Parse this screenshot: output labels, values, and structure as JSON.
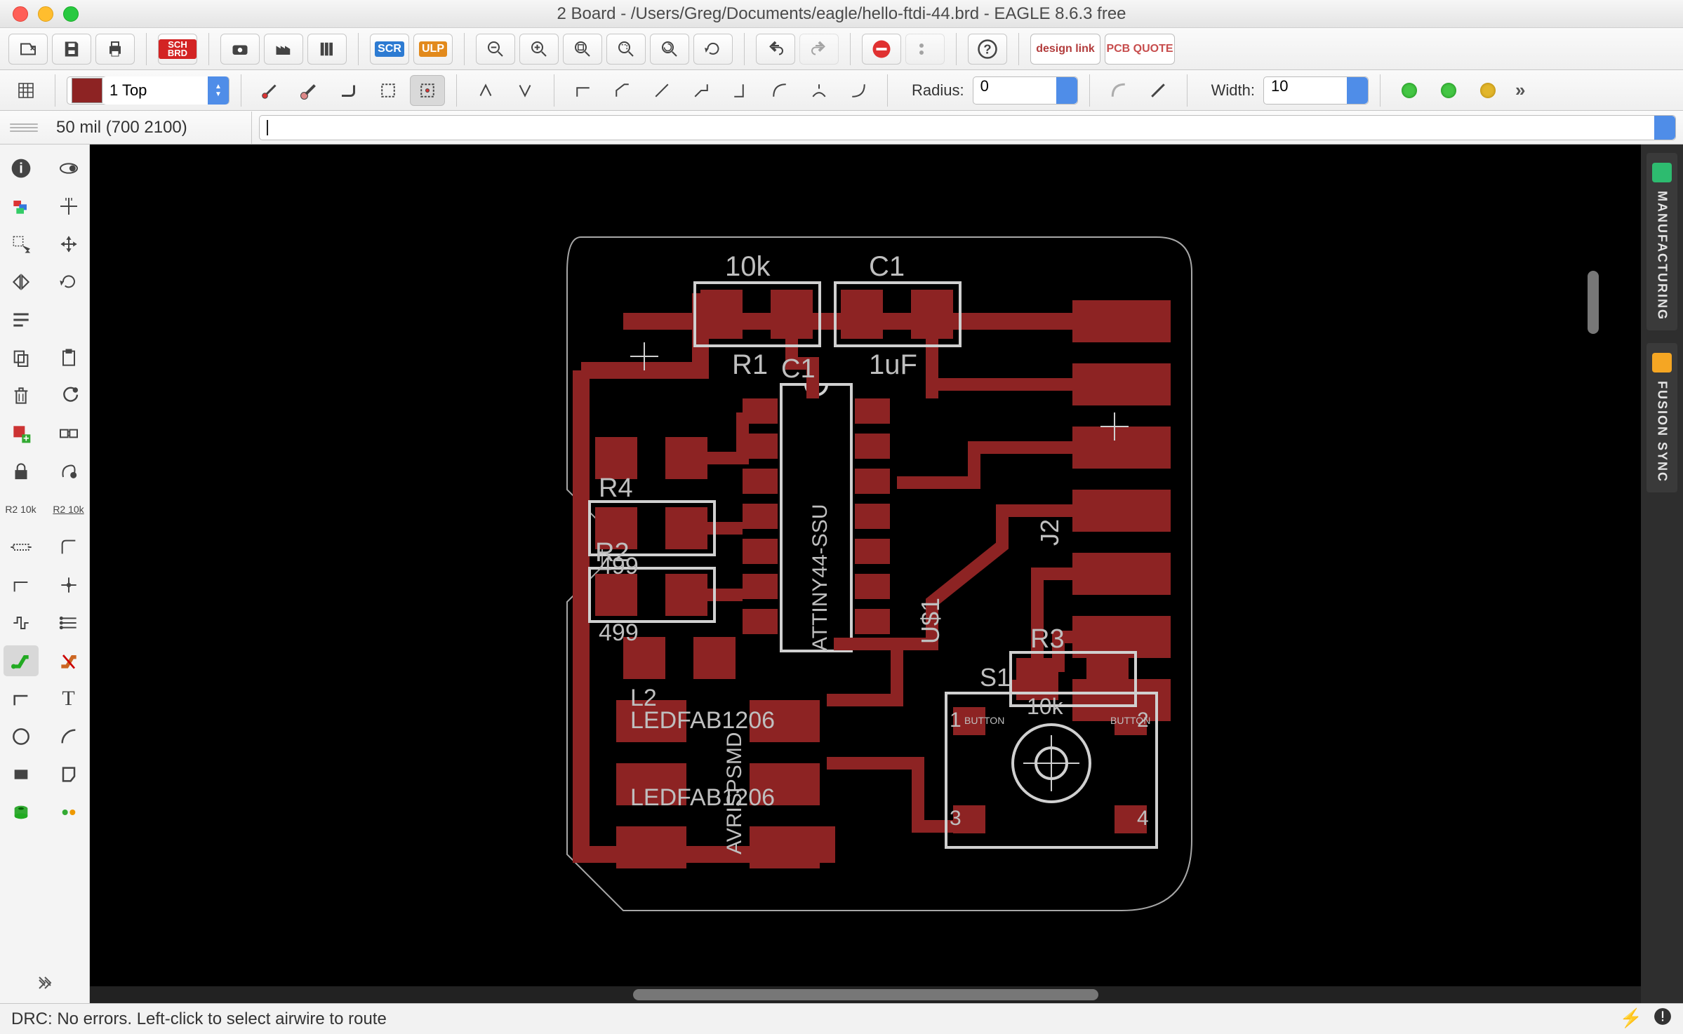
{
  "window": {
    "title": "2 Board - /Users/Greg/Documents/eagle/hello-ftdi-44.brd - EAGLE 8.6.3 free"
  },
  "toolbar1": {
    "open_icon": "open",
    "save_icon": "save",
    "print_icon": "print",
    "schbrd_label": "SCH\nBRD",
    "cam_icon": "cam",
    "manufacture_icon": "factory",
    "library_icon": "library",
    "scr_label": "SCR",
    "ulp_label": "ULP",
    "zoom_out": "zoom-out",
    "zoom_in": "zoom-in",
    "zoom_fit": "zoom-fit",
    "zoom_area": "zoom-select",
    "zoom_redraw": "redraw",
    "zoom_refresh": "refresh",
    "undo": "undo",
    "redo": "redo",
    "stop": "stop",
    "go": "go",
    "help": "help",
    "brand1": "design link",
    "brand2": "PCB QUOTE"
  },
  "toolbar2": {
    "layer_name": "1 Top",
    "radius_label": "Radius:",
    "radius_value": "0",
    "width_label": "Width:",
    "width_value": "10"
  },
  "toolbar3": {
    "coord": "50 mil (700 2100)",
    "cmd_value": ""
  },
  "right_tabs": {
    "tab1": "MANUFACTURING",
    "tab2": "FUSION SYNC"
  },
  "status": {
    "text": "DRC: No errors. Left-click to select airwire to route"
  },
  "left_tools": {
    "labels_r2_10k_a": "R2 10k",
    "labels_r2_10k_b": "R2 10k"
  },
  "pcb_labels": {
    "tenk": "10k",
    "c1": "C1",
    "r1": "R1",
    "c1b": "C1",
    "oneuf": "1uF",
    "r4": "R4",
    "r499a": "499",
    "r2": "R2",
    "r499b": "499",
    "r3": "R3",
    "tenk2": "10k",
    "led1": "LEDFAB1206",
    "led2": "LEDFAB1206",
    "u51": "U$1",
    "s1": "S1",
    "j2": "J2",
    "attiny": "ATTINY44-SSU",
    "avrisp": "AVRISPSMD",
    "L2": "L2",
    "b1": "1",
    "b2": "2",
    "b3": "3",
    "b4": "4",
    "btn": "BUTTON"
  }
}
